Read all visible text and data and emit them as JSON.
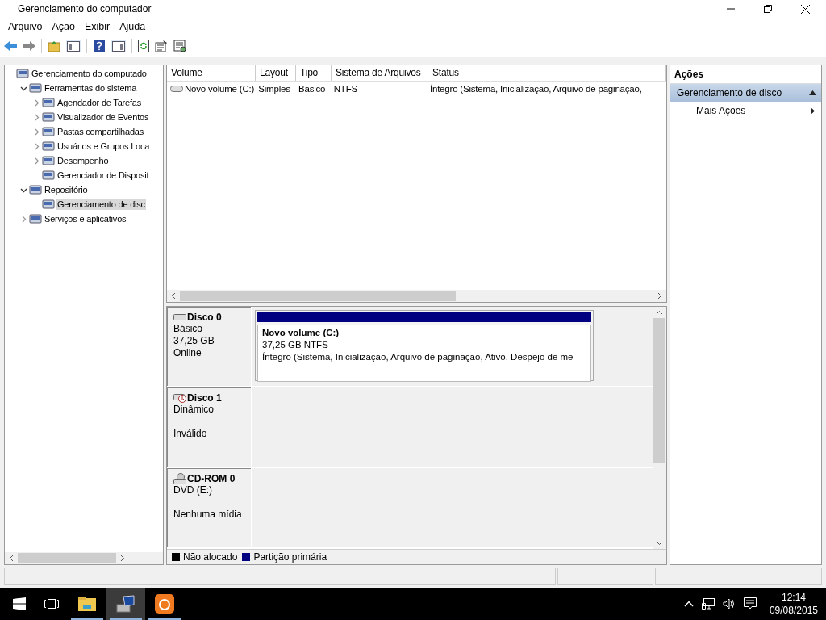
{
  "window": {
    "title": "Gerenciamento do computador"
  },
  "menu": [
    "Arquivo",
    "Ação",
    "Exibir",
    "Ajuda"
  ],
  "tree": {
    "label": "Gerenciamento do computado",
    "selected": false,
    "children": [
      {
        "label": "Ferramentas do sistema",
        "selected": false,
        "expanded": true,
        "children": [
          {
            "label": "Agendador de Tarefas",
            "selected": false,
            "expanded": false
          },
          {
            "label": "Visualizador de Eventos",
            "selected": false,
            "expanded": false
          },
          {
            "label": "Pastas compartilhadas",
            "selected": false,
            "expanded": false
          },
          {
            "label": "Usuários e Grupos Loca",
            "selected": false,
            "expanded": false
          },
          {
            "label": "Desempenho",
            "selected": false,
            "expanded": false
          },
          {
            "label": "Gerenciador de Disposit",
            "selected": false
          }
        ]
      },
      {
        "label": "Repositório",
        "selected": false,
        "expanded": true,
        "children": [
          {
            "label": "Gerenciamento de disc",
            "selected": true
          }
        ]
      },
      {
        "label": "Serviços e aplicativos",
        "selected": false,
        "expanded": false
      }
    ]
  },
  "volume_table": {
    "columns": [
      "Volume",
      "Layout",
      "Tipo",
      "Sistema de Arquivos",
      "Status"
    ],
    "rows": [
      [
        "Novo volume (C:)",
        "Simples",
        "Básico",
        "NTFS",
        "Íntegro (Sistema, Inicialização, Arquivo de paginação,"
      ]
    ]
  },
  "disks": [
    {
      "kind": "disk",
      "name": "Disco 0",
      "lines": [
        "Básico",
        "37,25 GB"
      ],
      "status": "Online",
      "partitions": [
        {
          "name": "Novo volume  (C:)",
          "size": "37,25 GB NTFS",
          "status": "Íntegro (Sistema, Inicialização, Arquivo de paginação, Ativo, Despejo de me",
          "color": "#000080"
        }
      ]
    },
    {
      "kind": "invalid",
      "name": "Disco 1",
      "lines": [
        "Dinâmico"
      ],
      "status": "Inválido"
    },
    {
      "kind": "cdrom",
      "name": "CD-ROM 0",
      "lines": [
        "DVD (E:)"
      ],
      "status": "Nenhuma mídia"
    }
  ],
  "legend": [
    {
      "label": "Não alocado",
      "color": "#000000"
    },
    {
      "label": "Partição primária",
      "color": "#000080"
    }
  ],
  "actions": {
    "title": "Ações",
    "section": {
      "label": "Gerenciamento de disco",
      "selected": true
    },
    "items": [
      "Mais Ações"
    ]
  },
  "taskbar": {
    "apps": [
      {
        "kind": "folder",
        "selected": false
      },
      {
        "kind": "computer",
        "selected": true
      },
      {
        "kind": "browser",
        "selected": false
      }
    ],
    "time": "12:14",
    "date": "09/08/2015"
  }
}
